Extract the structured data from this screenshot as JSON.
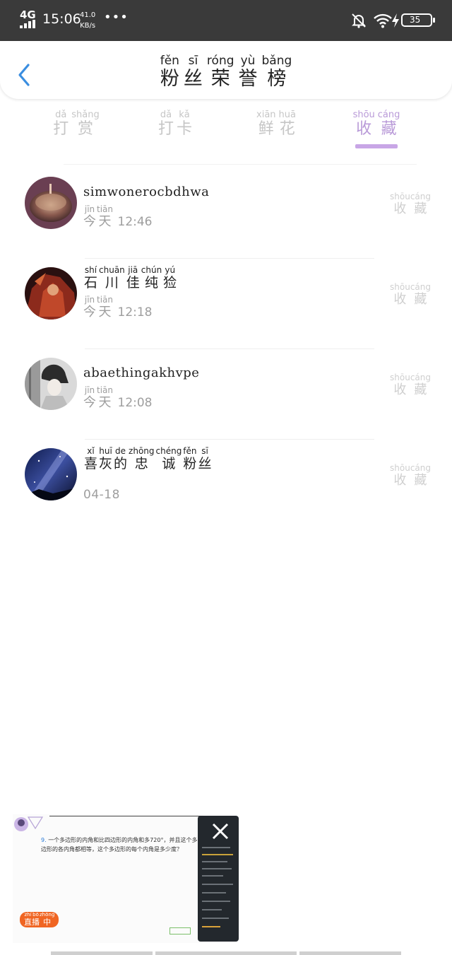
{
  "status_bar": {
    "network": "4G",
    "time": "15:06",
    "speed_value": "41.0",
    "speed_unit": "KB/s",
    "more": "•••",
    "battery": "35"
  },
  "header": {
    "title": [
      {
        "char": "粉",
        "pinyin": "fěn"
      },
      {
        "char": "丝",
        "pinyin": "sī"
      },
      {
        "char": "荣",
        "pinyin": "róng"
      },
      {
        "char": "誉",
        "pinyin": "yù"
      },
      {
        "char": "榜",
        "pinyin": "bǎng"
      }
    ]
  },
  "tabs": [
    {
      "chars": [
        {
          "char": "打",
          "pinyin": "dǎ"
        },
        {
          "char": "赏",
          "pinyin": "shǎng"
        }
      ],
      "active": false
    },
    {
      "chars": [
        {
          "char": "打",
          "pinyin": "dǎ"
        },
        {
          "char": "卡",
          "pinyin": "kǎ"
        }
      ],
      "active": false
    },
    {
      "chars": [
        {
          "char": "鲜",
          "pinyin": "xiān"
        },
        {
          "char": "花",
          "pinyin": "huā"
        }
      ],
      "active": false
    },
    {
      "chars": [
        {
          "char": "收",
          "pinyin": "shōu"
        },
        {
          "char": "藏",
          "pinyin": "cáng"
        }
      ],
      "active": true
    }
  ],
  "today": [
    {
      "char": "今",
      "pinyin": "jīn"
    },
    {
      "char": "天",
      "pinyin": "tiān"
    }
  ],
  "action": [
    {
      "char": "收",
      "pinyin": "shōu"
    },
    {
      "char": "藏",
      "pinyin": "cáng"
    }
  ],
  "rows": [
    {
      "name": "simwonerocbdhwa",
      "time": "12:46",
      "avatar": "avatar-orb"
    },
    {
      "name_chars": [
        {
          "char": "石",
          "pinyin": "shí"
        },
        {
          "char": "川",
          "pinyin": "chuān"
        },
        {
          "char": "佳",
          "pinyin": "jiā"
        },
        {
          "char": "纯",
          "pinyin": "chún"
        },
        {
          "char": "猃",
          "pinyin": "yú"
        }
      ],
      "time": "12:18",
      "avatar": "avatar-warrior"
    },
    {
      "name": "abaethingakhvpe",
      "time": "12:08",
      "avatar": "avatar-portrait"
    },
    {
      "name_chars": [
        {
          "char": "喜",
          "pinyin": "xǐ"
        },
        {
          "char": "灰",
          "pinyin": "huī"
        },
        {
          "char": "的",
          "pinyin": "de"
        },
        {
          "char": "忠",
          "pinyin": "zhōng"
        },
        {
          "char": "诚",
          "pinyin": "chéng"
        },
        {
          "char": "粉",
          "pinyin": "fěn"
        },
        {
          "char": "丝",
          "pinyin": "sī"
        }
      ],
      "date": "04-18",
      "avatar": "avatar-galaxy"
    }
  ],
  "pip": {
    "question_number": "9.",
    "question_text": "一个多边形的内角和比四边形的内角和多720°，并且这个多边形的各内角都相等，这个多边形的每个内角是多少度？",
    "live": [
      {
        "char": "直",
        "pinyin": "zhí"
      },
      {
        "char": "播",
        "pinyin": "bō"
      },
      {
        "char": "中",
        "pinyin": "zhōng"
      }
    ]
  }
}
